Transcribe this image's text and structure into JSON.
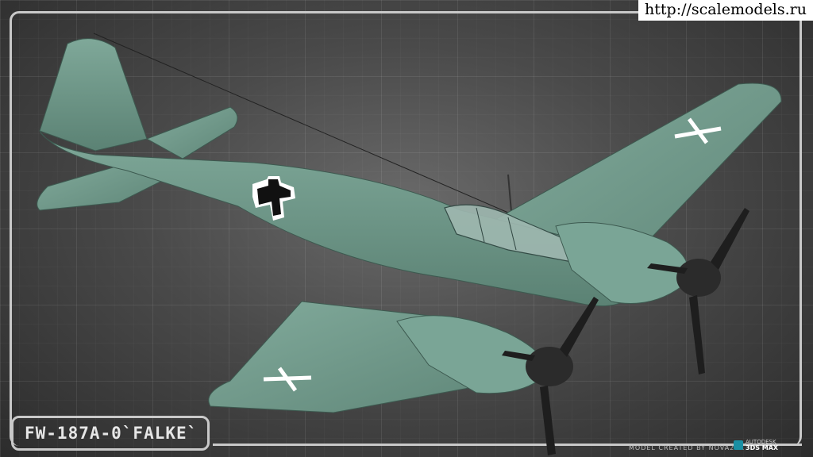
{
  "watermark": {
    "url": "http://scalemodels.ru"
  },
  "title": {
    "text": "FW-187A-0`FALKE`"
  },
  "credit": {
    "text": "MODEL CREATED BY NOVA29R",
    "vendor": "AUTODESK",
    "product": "3DS MAX"
  },
  "colors": {
    "airframe": "#6f9a8a",
    "airframe_shadow": "#4f7468",
    "nacelle": "#7aa596",
    "spinner": "#2b2b2b",
    "prop": "#1e1e1e",
    "background": "#4a4a4a",
    "frame": "#c9c9c9"
  },
  "scene": {
    "subject": "twin-engine fighter aircraft 3D model render",
    "markings": [
      "balkenkreuz-fuselage",
      "balkenkreuz-wing-right",
      "balkenkreuz-wing-left"
    ]
  }
}
